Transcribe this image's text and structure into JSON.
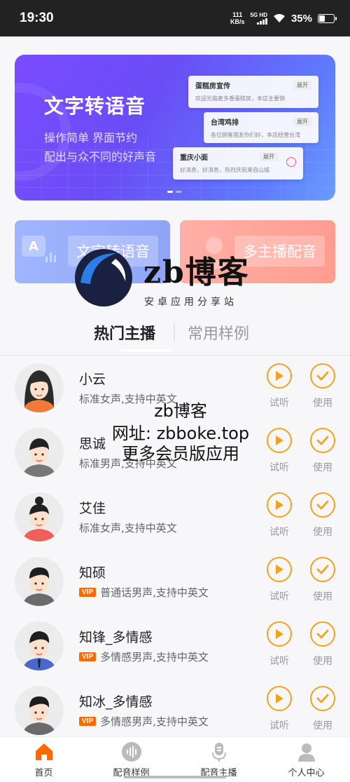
{
  "status": {
    "time": "19:30",
    "net_speed_top": "111",
    "net_speed_bottom": "KB/s",
    "network_5g": "5G HD",
    "battery_text": "35%",
    "battery_level": 0.35
  },
  "banner": {
    "title": "文字转语音",
    "subtitle_line1": "操作简单 界面节约",
    "subtitle_line2": "配出与众不同的好声音",
    "cards": [
      {
        "name": "蛋糕房宣传",
        "tag": "展开",
        "text": "欢迎光临麦多香蛋糕房，本店主要销"
      },
      {
        "name": "台湾鸡排",
        "tag": "展开",
        "text": "各位顾客朋友你们好，本店经营台湾"
      },
      {
        "name": "重庆小面",
        "tag": "展开",
        "text": "好消息，好消息，热烈庆祝来自山城"
      }
    ]
  },
  "tiles": {
    "left_label": "文字转语音",
    "left_icon_letter": "A",
    "right_label": "多主播配音"
  },
  "watermark": {
    "brand": "zb博客",
    "tagline": "安卓应用分享站",
    "overlay_line1": "zb博客",
    "overlay_line2": "网址: zbboke.top",
    "overlay_line3": "更多会员版应用"
  },
  "tabs": {
    "hot": "热门主播",
    "common": "常用样例"
  },
  "voices": [
    {
      "name": "小云",
      "desc": "标准女声,支持中英文",
      "vip": "",
      "play_label": "试听",
      "use_label": "使用"
    },
    {
      "name": "思诚",
      "desc": "标准男声,支持中英文",
      "vip": "",
      "play_label": "试听",
      "use_label": "使用"
    },
    {
      "name": "艾佳",
      "desc": "标准女声,支持中英文",
      "vip": "",
      "play_label": "试听",
      "use_label": "使用"
    },
    {
      "name": "知硕",
      "desc": "普通话男声,支持中英文",
      "vip": "VIP",
      "play_label": "试听",
      "use_label": "使用"
    },
    {
      "name": "知锋_多情感",
      "desc": "多情感男声,支持中英文",
      "vip": "VIP",
      "play_label": "试听",
      "use_label": "使用"
    },
    {
      "name": "知冰_多情感",
      "desc": "多情感男声,支持中英文",
      "vip": "VIP",
      "play_label": "试听",
      "use_label": "使用"
    }
  ],
  "bottom_nav": [
    {
      "label": "首页",
      "icon": "home-icon"
    },
    {
      "label": "配音样例",
      "icon": "waveform-icon"
    },
    {
      "label": "配音主播",
      "icon": "microphone-icon"
    },
    {
      "label": "个人中心",
      "icon": "person-icon"
    }
  ],
  "colors": {
    "accent": "#f5a11c",
    "home_active": "#ff6a00",
    "vip": "#ff6a00",
    "banner": "#6a4df5"
  }
}
